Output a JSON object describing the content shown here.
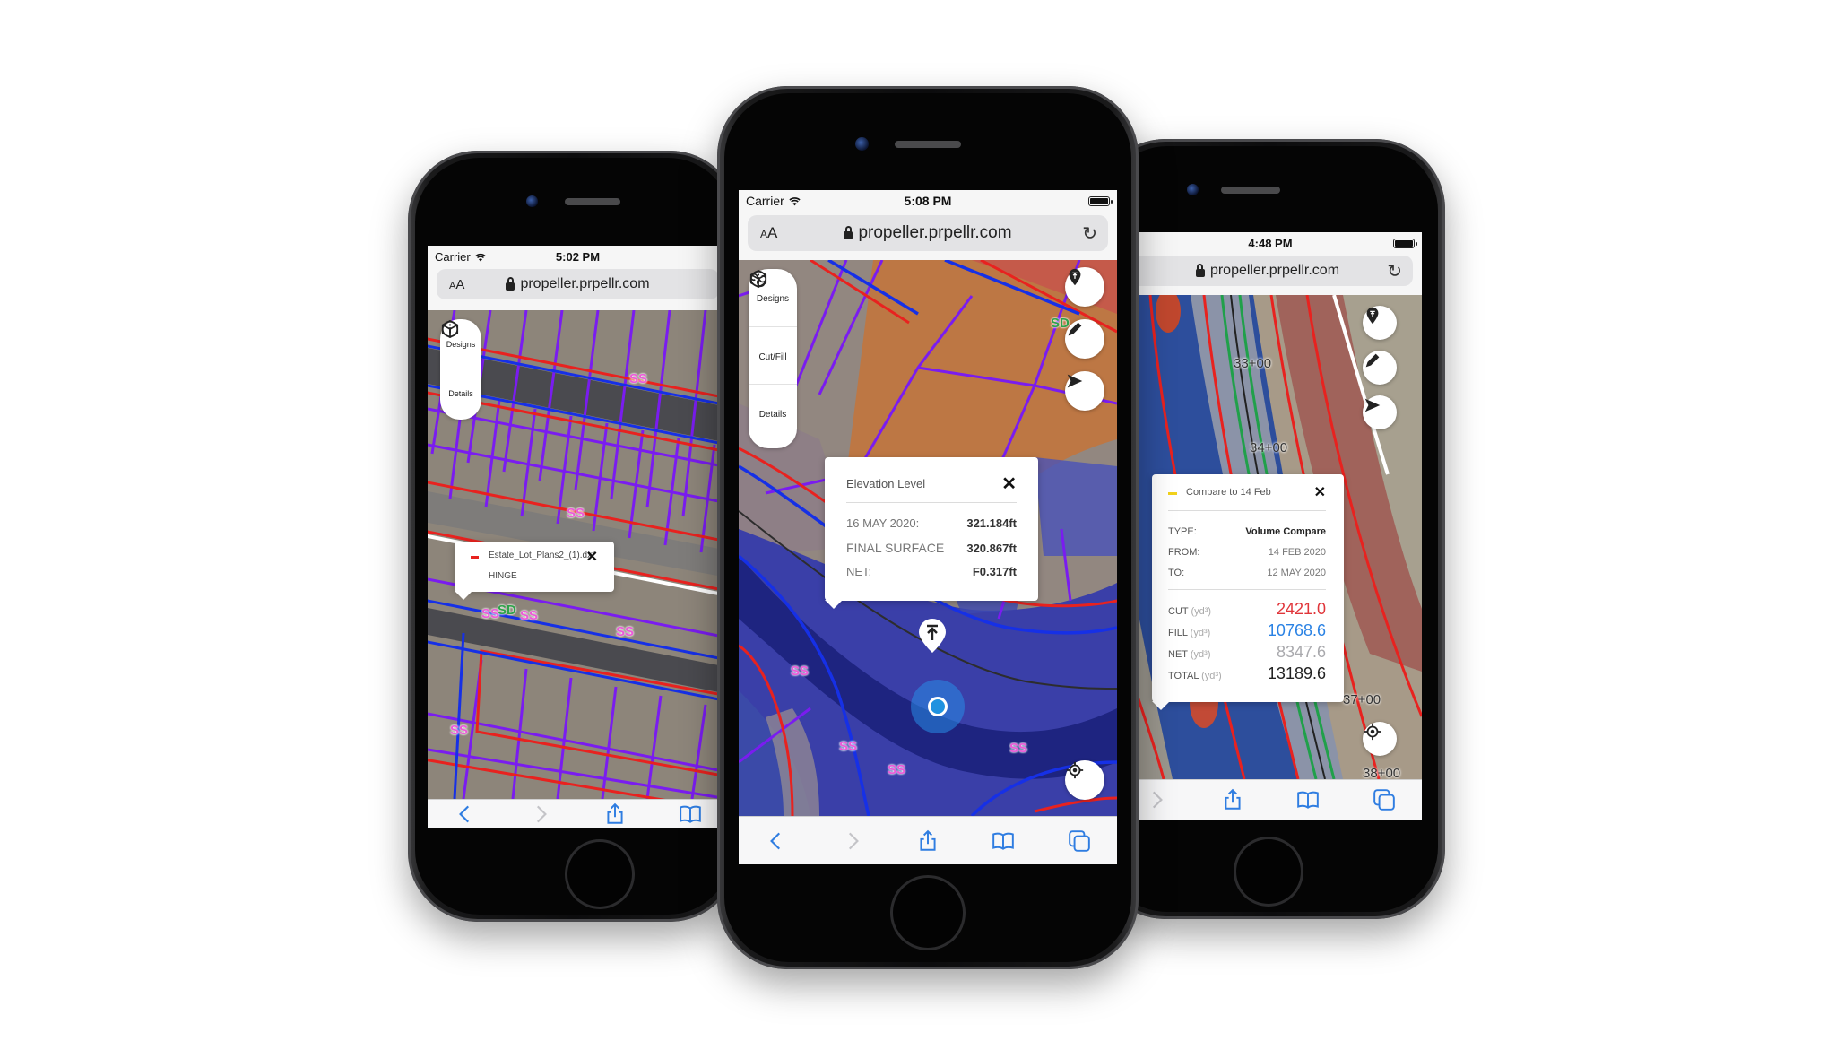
{
  "phones": {
    "left": {
      "status": {
        "carrier": "Carrier",
        "time": "5:02 PM"
      },
      "url_bar": {
        "text_size": "AA",
        "url": "propeller.prpellr.com"
      },
      "tools": [
        {
          "label": "Designs",
          "icon": "cube-icon"
        },
        {
          "label": "Details",
          "icon": "info-icon"
        }
      ],
      "popup": {
        "file_name": "Estate_Lot_Plans2_(1).dxf",
        "layer": "HINGE",
        "swatch_color": "#e8221f"
      },
      "map_labels": [
        "SS",
        "SS",
        "SS",
        "SD",
        "SS",
        "SS",
        "SS"
      ],
      "bottom_nav": [
        "back",
        "forward",
        "share",
        "bookmarks"
      ]
    },
    "center": {
      "status": {
        "carrier": "Carrier",
        "time": "5:08 PM"
      },
      "url_bar": {
        "text_size": "AA",
        "url": "propeller.prpellr.com"
      },
      "tools": [
        {
          "label": "Designs",
          "icon": "cube-icon"
        },
        {
          "label": "Cut/Fill",
          "icon": "cut-fill-icon"
        },
        {
          "label": "Details",
          "icon": "info-icon"
        }
      ],
      "popup": {
        "title": "Elevation Level",
        "rows": [
          {
            "label": "16 MAY 2020:",
            "value": "321.184ft"
          },
          {
            "label": "FINAL SURFACE",
            "value": "320.867ft"
          },
          {
            "label": "NET:",
            "value": "F0.317ft"
          }
        ]
      },
      "map_labels": [
        "SD",
        "SS",
        "SS",
        "SS",
        "SS"
      ],
      "bottom_nav": [
        "back",
        "forward",
        "share",
        "bookmarks",
        "tabs"
      ]
    },
    "right": {
      "status": {
        "time": "4:48 PM"
      },
      "url_bar": {
        "url": "propeller.prpellr.com"
      },
      "popup": {
        "title": "Compare to 14 Feb",
        "swatch_color": "#f2d21b",
        "info_rows": [
          {
            "label": "TYPE:",
            "value": "Volume Compare"
          },
          {
            "label": "FROM:",
            "value": "14 FEB 2020"
          },
          {
            "label": "TO:",
            "value": "12 MAY 2020"
          }
        ],
        "volume_rows": [
          {
            "label": "CUT",
            "unit": "(yd³)",
            "value": "2421.0",
            "color": "#e0353a"
          },
          {
            "label": "FILL",
            "unit": "(yd³)",
            "value": "10768.6",
            "color": "#2a82e4"
          },
          {
            "label": "NET",
            "unit": "(yd³)",
            "value": "8347.6",
            "color": "#a9a9ad"
          },
          {
            "label": "TOTAL",
            "unit": "(yd³)",
            "value": "13189.6",
            "color": "#222222"
          }
        ]
      },
      "stations": [
        "33+00",
        "34+00",
        "37+00",
        "38+00"
      ],
      "bottom_nav": [
        "forward",
        "share",
        "bookmarks",
        "tabs"
      ]
    }
  },
  "colors": {
    "accent_blue": "#2f7de1",
    "design_red": "#e8221f",
    "design_purple": "#7a1cf0",
    "design_blue": "#1630e6"
  }
}
